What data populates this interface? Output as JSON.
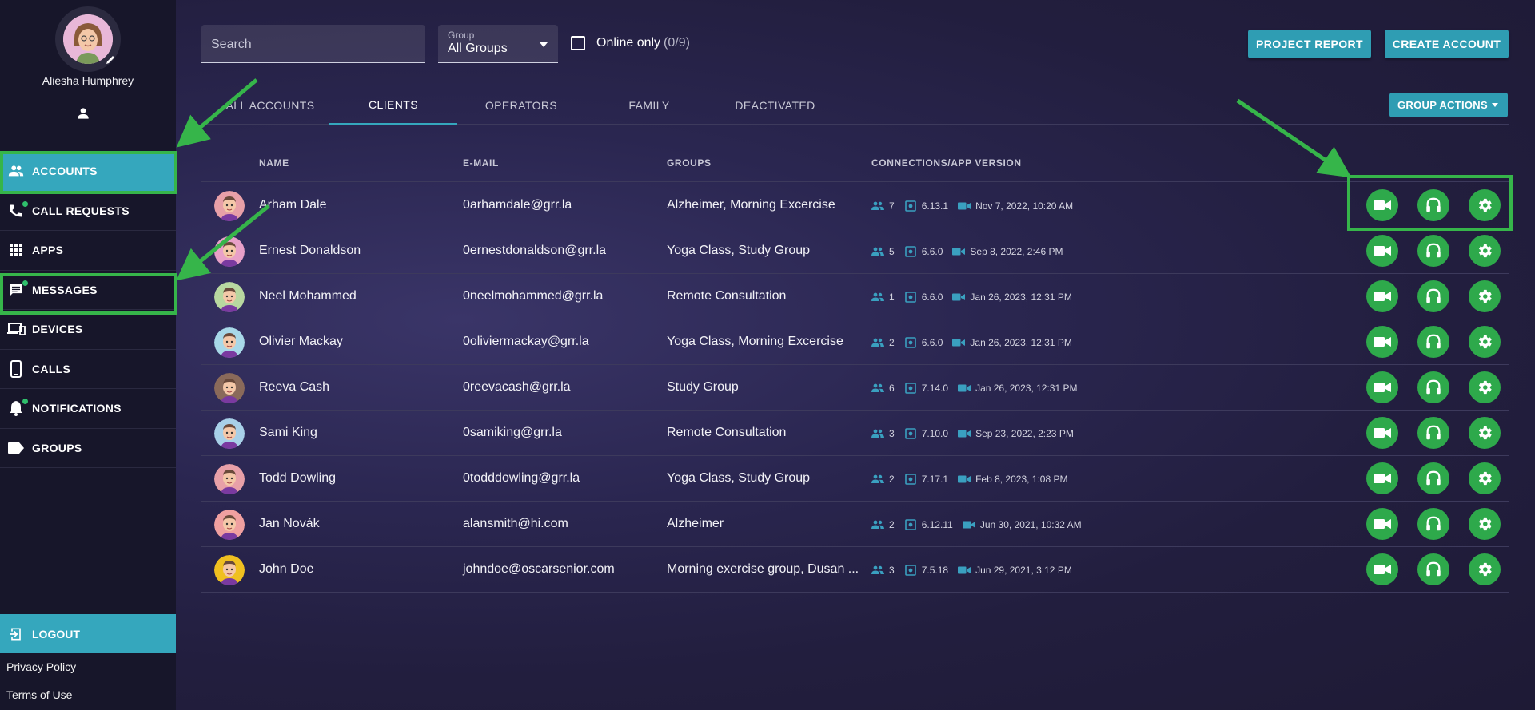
{
  "profile": {
    "name": "Aliesha Humphrey"
  },
  "nav": {
    "items": [
      {
        "label": "ACCOUNTS",
        "icon": "people-icon",
        "active": true,
        "dot": false
      },
      {
        "label": "CALL REQUESTS",
        "icon": "phone-icon",
        "active": false,
        "dot": true
      },
      {
        "label": "APPS",
        "icon": "apps-grid-icon",
        "active": false,
        "dot": false
      },
      {
        "label": "MESSAGES",
        "icon": "message-icon",
        "active": false,
        "dot": true
      },
      {
        "label": "DEVICES",
        "icon": "devices-icon",
        "active": false,
        "dot": false
      },
      {
        "label": "CALLS",
        "icon": "smartphone-icon",
        "active": false,
        "dot": false
      },
      {
        "label": "NOTIFICATIONS",
        "icon": "bell-icon",
        "active": false,
        "dot": true
      },
      {
        "label": "GROUPS",
        "icon": "label-icon",
        "active": false,
        "dot": false
      }
    ],
    "logout": "LOGOUT",
    "privacy": "Privacy Policy",
    "terms": "Terms of Use"
  },
  "toolbar": {
    "search_placeholder": "Search",
    "group_label": "Group",
    "group_value": "All Groups",
    "online_label": "Online only",
    "online_count": "(0/9)",
    "project_report": "PROJECT REPORT",
    "create_account": "CREATE ACCOUNT",
    "group_actions": "GROUP ACTIONS"
  },
  "tabs": [
    "ALL ACCOUNTS",
    "CLIENTS",
    "OPERATORS",
    "FAMILY",
    "DEACTIVATED"
  ],
  "active_tab": "CLIENTS",
  "table": {
    "headers": {
      "name": "NAME",
      "email": "E-MAIL",
      "groups": "GROUPS",
      "conn": "CONNECTIONS/APP VERSION"
    },
    "rows": [
      {
        "name": "Arham Dale",
        "email": "0arhamdale@grr.la",
        "groups": "Alzheimer, Morning Excercise",
        "connections": "7",
        "version": "6.13.1",
        "last_call": "Nov 7, 2022, 10:20 AM",
        "avatar_color": "#e8a0a8"
      },
      {
        "name": "Ernest Donaldson",
        "email": "0ernestdonaldson@grr.la",
        "groups": "Yoga Class, Study Group",
        "connections": "5",
        "version": "6.6.0",
        "last_call": "Sep 8, 2022, 2:46 PM",
        "avatar_color": "#e8a0c8"
      },
      {
        "name": "Neel Mohammed",
        "email": "0neelmohammed@grr.la",
        "groups": "Remote Consultation",
        "connections": "1",
        "version": "6.6.0",
        "last_call": "Jan 26, 2023, 12:31 PM",
        "avatar_color": "#b8d8a0"
      },
      {
        "name": "Olivier Mackay",
        "email": "0oliviermackay@grr.la",
        "groups": "Yoga Class, Morning Excercise",
        "connections": "2",
        "version": "6.6.0",
        "last_call": "Jan 26, 2023, 12:31 PM",
        "avatar_color": "#a8d8e8"
      },
      {
        "name": "Reeva Cash",
        "email": "0reevacash@grr.la",
        "groups": "Study Group",
        "connections": "6",
        "version": "7.14.0",
        "last_call": "Jan 26, 2023, 12:31 PM",
        "avatar_color": "#8a6a5a"
      },
      {
        "name": "Sami King",
        "email": "0samiking@grr.la",
        "groups": "Remote Consultation",
        "connections": "3",
        "version": "7.10.0",
        "last_call": "Sep 23, 2022, 2:23 PM",
        "avatar_color": "#a8d0e8"
      },
      {
        "name": "Todd Dowling",
        "email": "0todddowling@grr.la",
        "groups": "Yoga Class, Study Group",
        "connections": "2",
        "version": "7.17.1",
        "last_call": "Feb 8, 2023, 1:08 PM",
        "avatar_color": "#e8a0a8"
      },
      {
        "name": "Jan Novák",
        "email": "alansmith@hi.com",
        "groups": "Alzheimer",
        "connections": "2",
        "version": "6.12.11",
        "last_call": "Jun 30, 2021, 10:32 AM",
        "avatar_color": "#f0a0a0"
      },
      {
        "name": "John Doe",
        "email": "johndoe@oscarsenior.com",
        "groups": "Morning exercise group, Dusan ...",
        "connections": "3",
        "version": "7.5.18",
        "last_call": "Jun 29, 2021, 3:12 PM",
        "avatar_color": "#f0c020"
      }
    ]
  },
  "colors": {
    "accent": "#35a7bd",
    "action_green": "#2ea94b",
    "highlight": "#36b54a"
  }
}
